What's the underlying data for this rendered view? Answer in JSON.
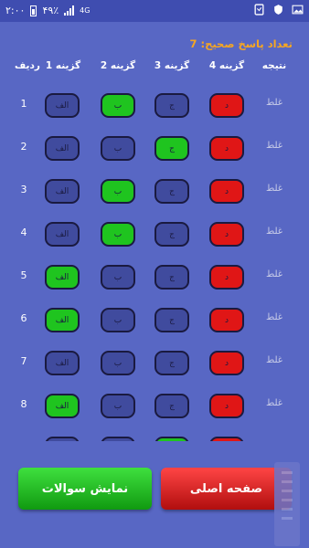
{
  "status_bar": {
    "time": "۲:۰۰",
    "battery": "۴۹٪",
    "network": "4G",
    "icons": [
      "image-icon",
      "shield-icon",
      "sim-icon"
    ]
  },
  "summary": {
    "label": "تعداد پاسخ صحیح:",
    "value": "7"
  },
  "table": {
    "headers": {
      "result": "نتیجه",
      "option4": "گزینه 4",
      "option3": "گزینه 3",
      "option2": "گزینه 2",
      "option1": "گزینه 1",
      "row": "ردیف"
    },
    "option_labels": [
      "الف",
      "ب",
      "ج",
      "د"
    ],
    "rows": [
      {
        "num": "1",
        "result": "غلط",
        "states": [
          "neutral",
          "green",
          "neutral",
          "red"
        ]
      },
      {
        "num": "2",
        "result": "غلط",
        "states": [
          "neutral",
          "neutral",
          "green",
          "red"
        ]
      },
      {
        "num": "3",
        "result": "غلط",
        "states": [
          "neutral",
          "green",
          "neutral",
          "red"
        ]
      },
      {
        "num": "4",
        "result": "غلط",
        "states": [
          "neutral",
          "green",
          "neutral",
          "red"
        ]
      },
      {
        "num": "5",
        "result": "غلط",
        "states": [
          "green",
          "neutral",
          "neutral",
          "red"
        ]
      },
      {
        "num": "6",
        "result": "غلط",
        "states": [
          "green",
          "neutral",
          "neutral",
          "red"
        ]
      },
      {
        "num": "7",
        "result": "غلط",
        "states": [
          "neutral",
          "neutral",
          "neutral",
          "red"
        ]
      },
      {
        "num": "8",
        "result": "غلط",
        "states": [
          "green",
          "neutral",
          "neutral",
          "red"
        ]
      },
      {
        "num": "",
        "result": "",
        "states": [
          "neutral",
          "neutral",
          "green",
          "red"
        ]
      }
    ]
  },
  "buttons": {
    "show_questions": "نمایش سوالات",
    "home": "صفحه اصلی"
  },
  "colors": {
    "background": "#5867c4",
    "accent": "#f5a623",
    "correct": "#1fc41f",
    "wrong": "#e01616"
  }
}
